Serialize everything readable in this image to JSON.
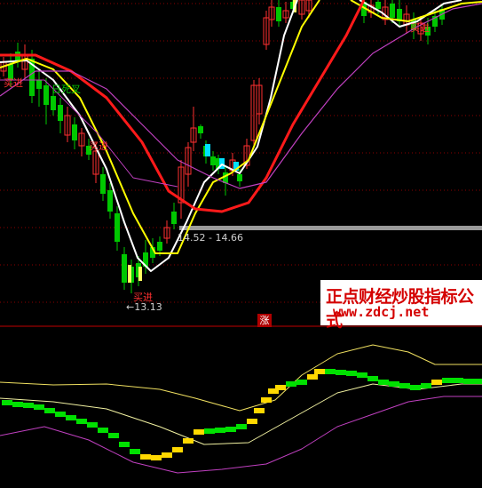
{
  "labels": {
    "price_range": "14.52 - 14.66",
    "low_price": "←13.13",
    "death_cross": "日死叉",
    "buy_signal": "买进",
    "rise_badge": "涨"
  },
  "watermark": {
    "title": "正点财经炒股指标公式",
    "url": "www.zdcj.net"
  },
  "colors": {
    "background": "#000000",
    "up_candle": "#ff3030",
    "down_candle": "#00c800",
    "ma_white": "#ffffff",
    "ma_yellow": "#ffff00",
    "ma_red": "#ff1a1a",
    "band_purple": "#c040c0",
    "grid": "#8b0000",
    "indicator_green": "#00e000",
    "indicator_yellow": "#ffd800"
  },
  "icons": {
    "rise_badge": "red-square-badge",
    "low_arrow": "left-arrow"
  }
}
